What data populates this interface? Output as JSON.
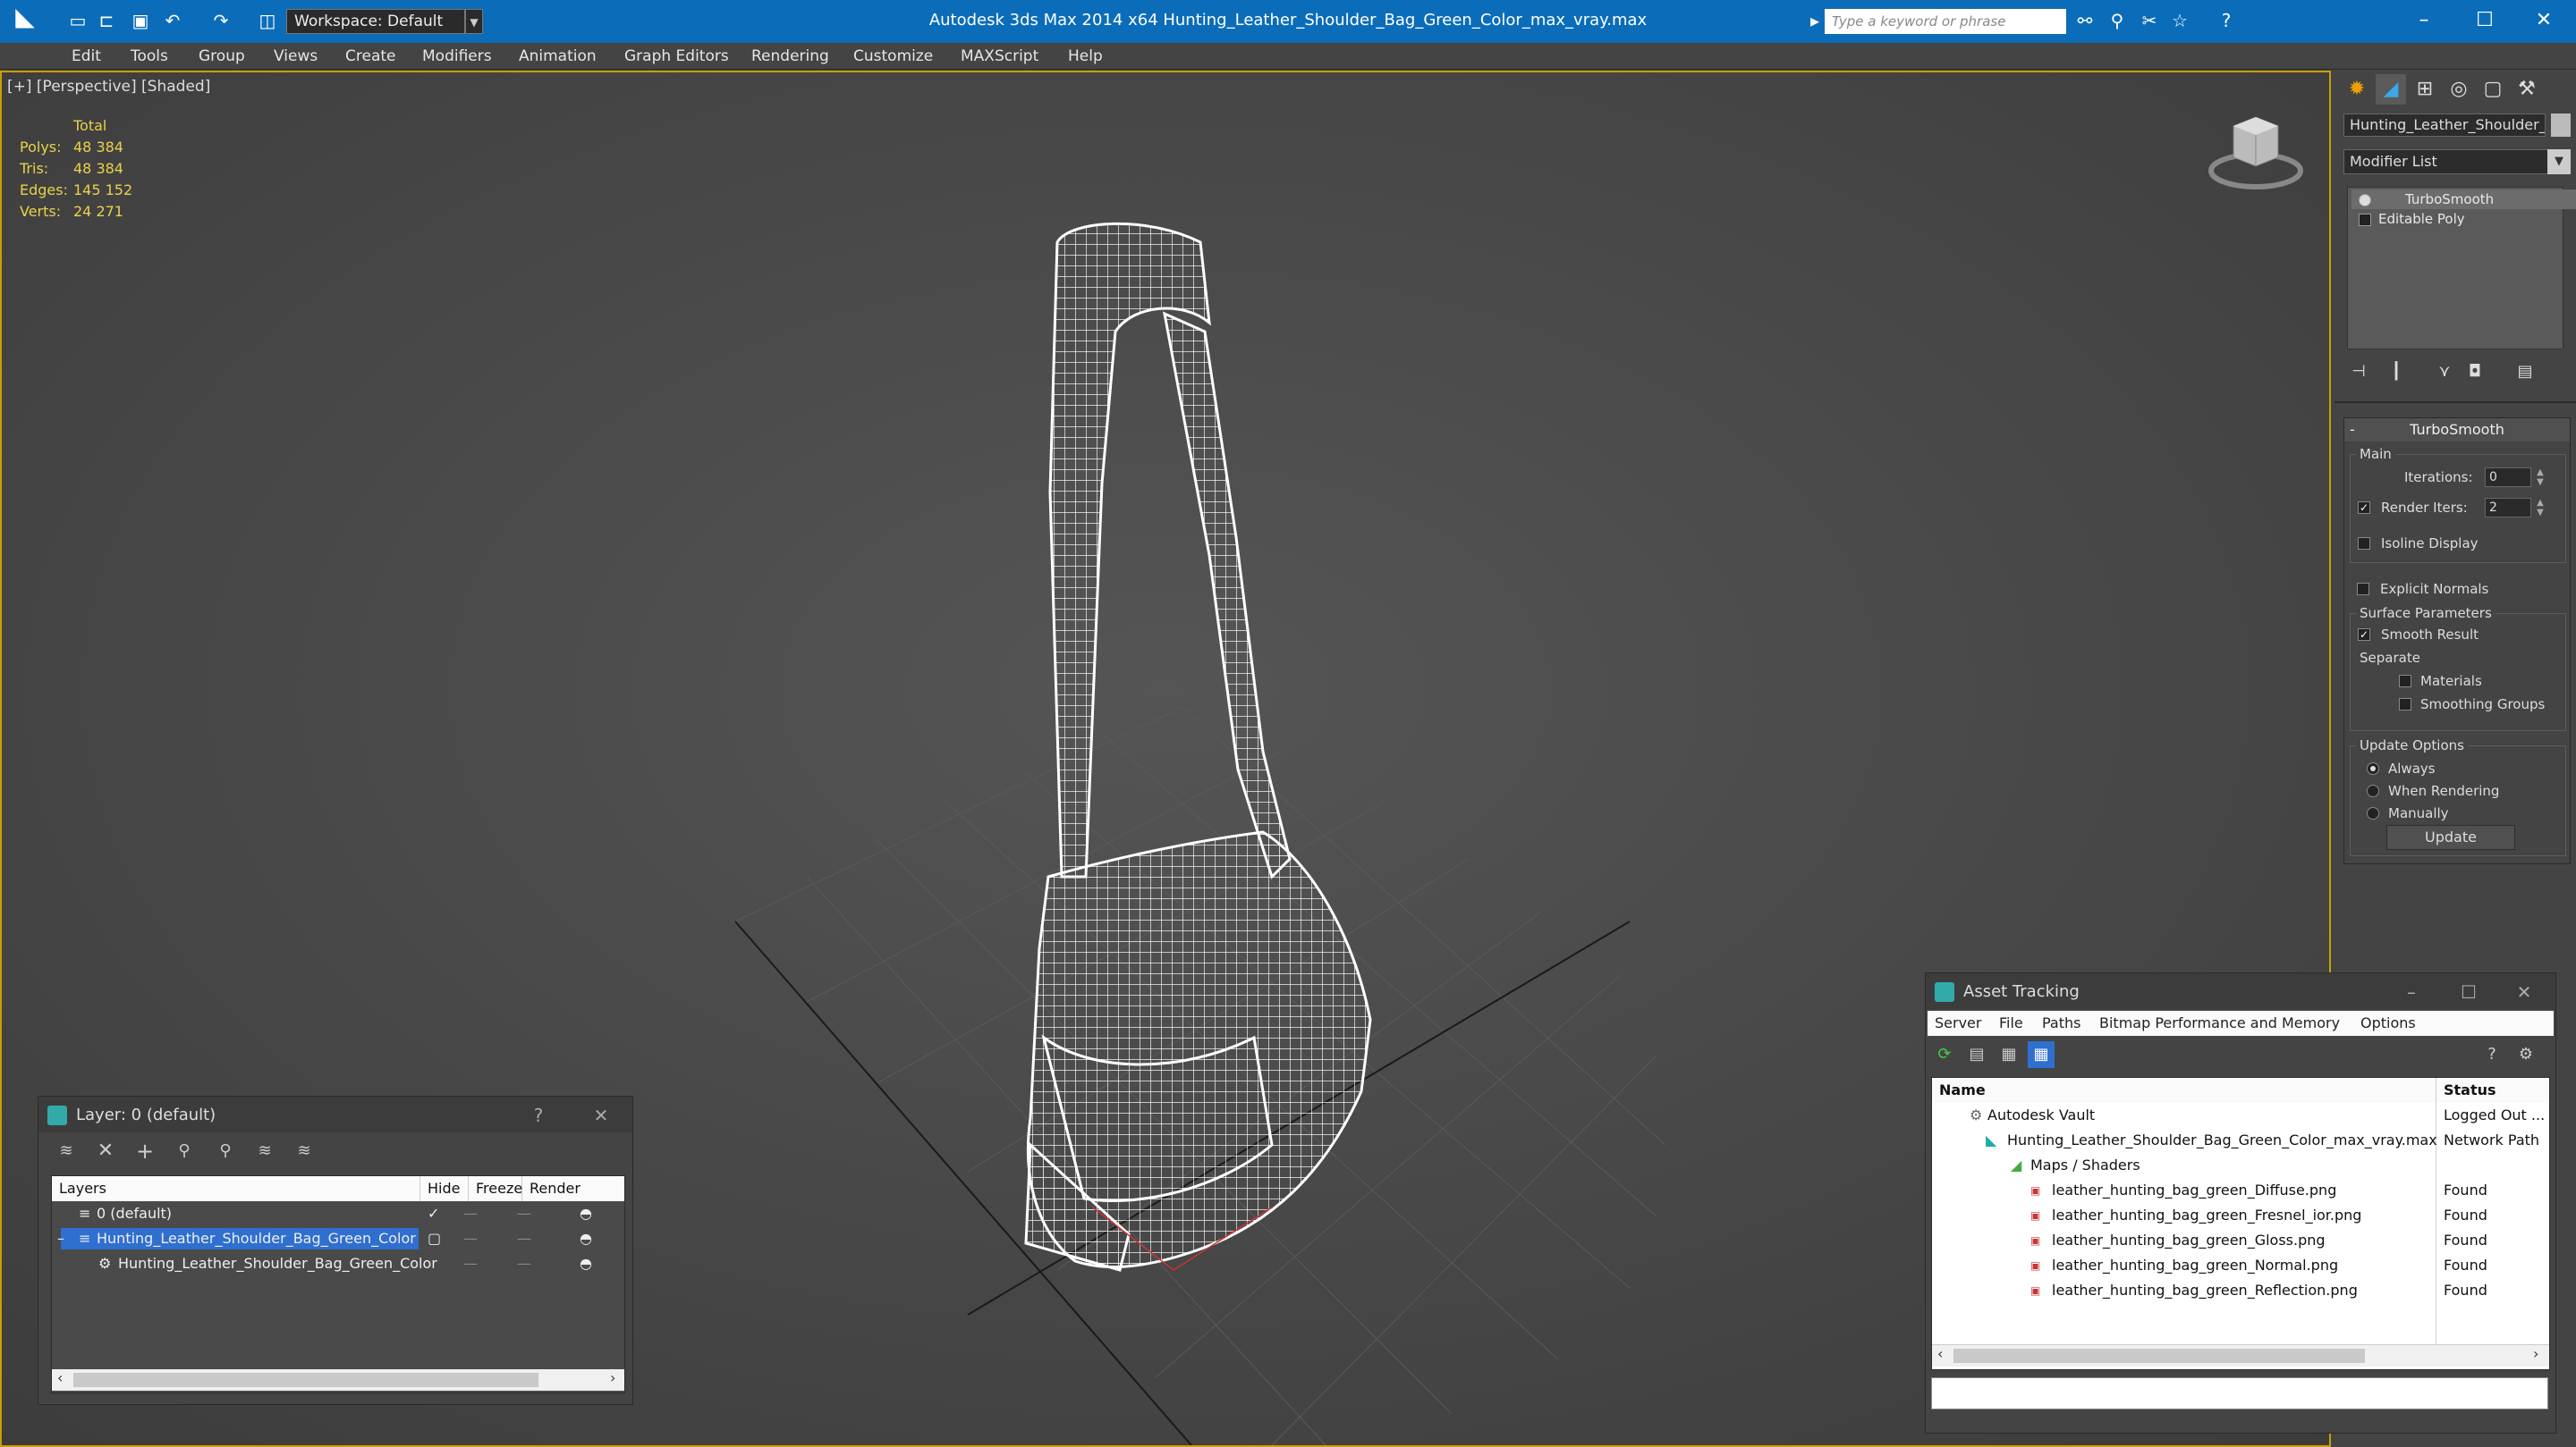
{
  "titlebar": {
    "title": "Autodesk 3ds Max  2014 x64      Hunting_Leather_Shoulder_Bag_Green_Color_max_vray.max",
    "workspace": "Workspace: Default",
    "search_placeholder": "Type a keyword or phrase"
  },
  "menu": [
    "Edit",
    "Tools",
    "Group",
    "Views",
    "Create",
    "Modifiers",
    "Animation",
    "Graph Editors",
    "Rendering",
    "Customize",
    "MAXScript",
    "Help"
  ],
  "viewport": {
    "label": "[+] [Perspective] [Shaded]",
    "stats": {
      "header": "Total",
      "polys_label": "Polys:",
      "polys": "48 384",
      "tris_label": "Tris:",
      "tris": "48 384",
      "edges_label": "Edges:",
      "edges": "145 152",
      "verts_label": "Verts:",
      "verts": "24 271"
    }
  },
  "command_panel": {
    "object_name": "Hunting_Leather_Shoulder_B",
    "modifier_list": "Modifier List",
    "stack": [
      "TurboSmooth",
      "Editable Poly"
    ],
    "turbosmooth": {
      "header": "TurboSmooth",
      "main": "Main",
      "iterations_label": "Iterations:",
      "iterations": "0",
      "render_iters_label": "Render Iters:",
      "render_iters": "2",
      "isoline": "Isoline Display",
      "explicit": "Explicit Normals",
      "surface": "Surface Parameters",
      "smooth_result": "Smooth Result",
      "separate": "Separate",
      "materials": "Materials",
      "smoothing_groups": "Smoothing Groups",
      "update_options": "Update Options",
      "always": "Always",
      "when_rendering": "When Rendering",
      "manually": "Manually",
      "update_btn": "Update"
    }
  },
  "layer_dialog": {
    "title": "Layer: 0 (default)",
    "help": "?",
    "columns": [
      "Layers",
      "Hide",
      "Freeze",
      "Render"
    ],
    "rows": [
      "0 (default)",
      "Hunting_Leather_Shoulder_Bag_Green_Color",
      "Hunting_Leather_Shoulder_Bag_Green_Color"
    ]
  },
  "asset_dialog": {
    "title": "Asset Tracking",
    "menu": [
      "Server",
      "File",
      "Paths",
      "Bitmap Performance and Memory",
      "Options"
    ],
    "columns": [
      "Name",
      "Status"
    ],
    "rows": [
      {
        "name": "Autodesk Vault",
        "status": "Logged Out ..."
      },
      {
        "name": "Hunting_Leather_Shoulder_Bag_Green_Color_max_vray.max",
        "status": "Network Path"
      },
      {
        "name": "Maps / Shaders",
        "status": ""
      },
      {
        "name": "leather_hunting_bag_green_Diffuse.png",
        "status": "Found"
      },
      {
        "name": "leather_hunting_bag_green_Fresnel_ior.png",
        "status": "Found"
      },
      {
        "name": "leather_hunting_bag_green_Gloss.png",
        "status": "Found"
      },
      {
        "name": "leather_hunting_bag_green_Normal.png",
        "status": "Found"
      },
      {
        "name": "leather_hunting_bag_green_Reflection.png",
        "status": "Found"
      }
    ]
  },
  "colors": {
    "titlebar": "#0b6db9",
    "selection": "#2f6fcf",
    "stats": "#e8d24a",
    "viewport_border": "#c8a000"
  }
}
